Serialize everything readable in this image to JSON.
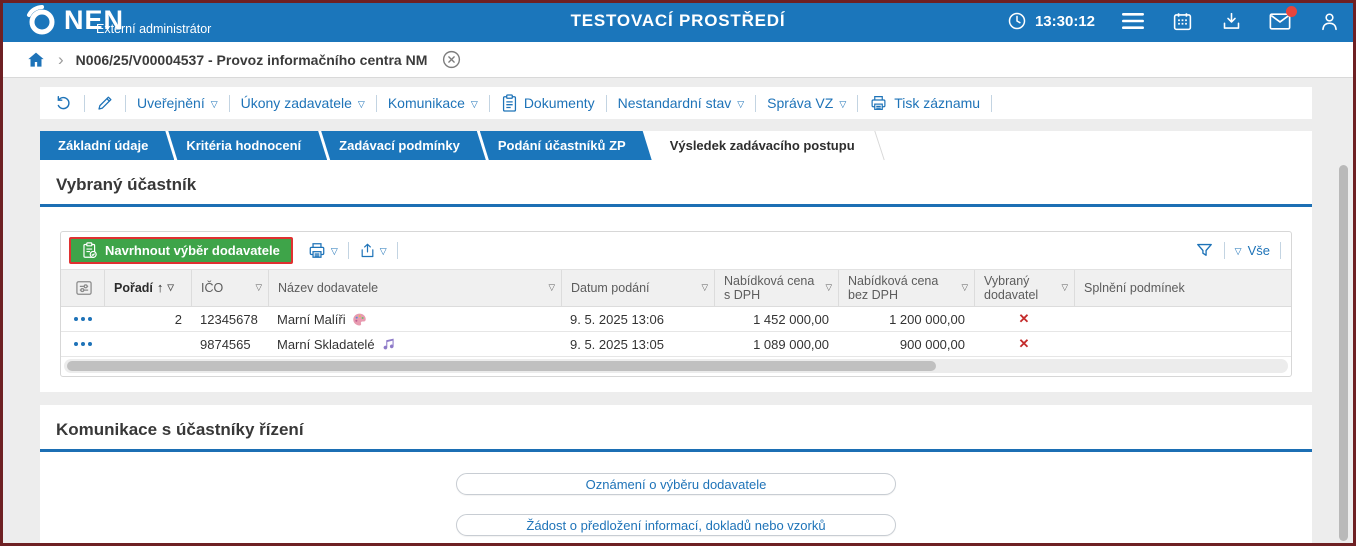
{
  "header": {
    "logo": "NEN",
    "user_role": "Externí administrátor",
    "environment": "TESTOVACÍ PROSTŘEDÍ",
    "time": "13:30:12"
  },
  "breadcrumb": {
    "record": "N006/25/V00004537 - Provoz informačního centra NM"
  },
  "toolbar": {
    "publish": "Uveřejnění",
    "contracting_actions": "Úkony zadavatele",
    "communication": "Komunikace",
    "documents": "Dokumenty",
    "nonstandard_state": "Nestandardní stav",
    "contract_admin": "Správa VZ",
    "print_record": "Tisk záznamu"
  },
  "tabs": {
    "basic": "Základní údaje",
    "criteria": "Kritéria hodnocení",
    "conditions": "Zadávací podmínky",
    "submissions": "Podání účastníků ZP",
    "result": "Výsledek zadávacího postupu"
  },
  "selected_participant": {
    "heading": "Vybraný účastník",
    "propose_button": "Navrhnout výběr dodavatele",
    "filter_all": "Vše",
    "table": {
      "columns": {
        "order": "Pořadí",
        "ico": "IČO",
        "supplier": "Název dodavatele",
        "submitted": "Datum podání",
        "price_with_vat": "Nabídková cena s DPH",
        "price_without_vat": "Nabídková cena bez DPH",
        "selected_supplier": "Vybraný dodavatel",
        "conditions_met": "Splnění podmínek"
      },
      "rows": [
        {
          "order": "2",
          "ico": "12345678",
          "supplier": "Marní Malíři",
          "supplier_icon": "palette-icon",
          "submitted": "9. 5. 2025 13:06",
          "price_with_vat": "1 452 000,00",
          "price_without_vat": "1 200 000,00",
          "selected": "✕",
          "conditions_met": ""
        },
        {
          "order": "",
          "ico": "9874565",
          "supplier": "Marní Skladatelé",
          "supplier_icon": "music-notes-icon",
          "submitted": "9. 5. 2025 13:05",
          "price_with_vat": "1 089 000,00",
          "price_without_vat": "900 000,00",
          "selected": "✕",
          "conditions_met": ""
        }
      ]
    }
  },
  "communication": {
    "heading": "Komunikace s účastníky řízení",
    "notice_button": "Oznámení o výběru dodavatele",
    "request_button": "Žádost o předložení informací, dokladů nebo vzorků"
  },
  "icons": {
    "dropdown": "▽",
    "sort_asc": "↑",
    "chevron": "›"
  },
  "colors": {
    "header_blue": "#1b76bb",
    "link_blue": "#1e73b8",
    "section_rule": "#1c6fb4",
    "green_button": "#3ea449",
    "focus_red": "#e03131",
    "reject_red": "#c42b2b",
    "badge_red": "#e8453c"
  }
}
